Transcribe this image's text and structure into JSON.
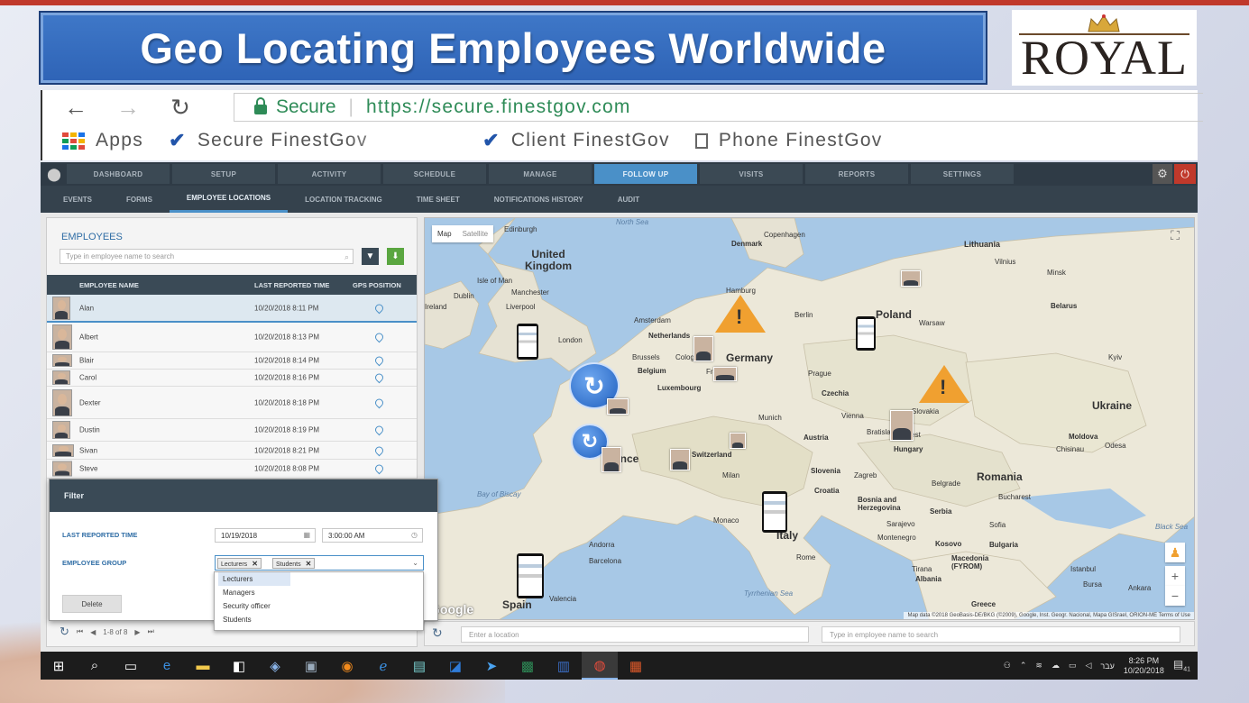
{
  "slide": {
    "title": "Geo Locating Employees Worldwide",
    "logo_text": "ROYAL"
  },
  "browser": {
    "back_icon": "←",
    "forward_icon": "→",
    "reload_icon": "↻",
    "secure_label": "Secure",
    "url": "https://secure.finestgov.com",
    "bookmarks": [
      {
        "label": "Apps"
      },
      {
        "label": "Secure FinestGov"
      },
      {
        "label": "Client FinestGov"
      },
      {
        "label": "Phone FinestGov"
      }
    ]
  },
  "topnav": {
    "tabs": [
      "DASHBOARD",
      "SETUP",
      "ACTIVITY",
      "SCHEDULE",
      "MANAGE",
      "FOLLOW UP",
      "VISITS",
      "REPORTS",
      "SETTINGS"
    ],
    "active": "FOLLOW UP"
  },
  "subnav": {
    "tabs": [
      "EVENTS",
      "FORMS",
      "EMPLOYEE LOCATIONS",
      "LOCATION TRACKING",
      "TIME SHEET",
      "NOTIFICATIONS HISTORY",
      "AUDIT"
    ],
    "active": "EMPLOYEE LOCATIONS"
  },
  "employees": {
    "heading": "EMPLOYEES",
    "search_placeholder": "Type in employee name to search",
    "columns": [
      "EMPLOYEE NAME",
      "LAST REPORTED TIME",
      "GPS POSITION"
    ],
    "rows": [
      {
        "name": "Alan",
        "time": "10/20/2018 8:11 PM"
      },
      {
        "name": "Albert",
        "time": "10/20/2018 8:13 PM"
      },
      {
        "name": "Blair",
        "time": "10/20/2018 8:14 PM"
      },
      {
        "name": "Carol",
        "time": "10/20/2018 8:16 PM"
      },
      {
        "name": "Dexter",
        "time": "10/20/2018 8:18 PM"
      },
      {
        "name": "Dustin",
        "time": "10/20/2018 8:19 PM"
      },
      {
        "name": "Sivan",
        "time": "10/20/2018 8:21 PM"
      },
      {
        "name": "Steve",
        "time": "10/20/2018 8:08 PM"
      }
    ],
    "pager_text": "1-8 of 8"
  },
  "filter": {
    "title": "Filter",
    "last_reported_label": "LAST REPORTED TIME",
    "date_value": "10/19/2018",
    "time_value": "3:00:00 AM",
    "group_label": "EMPLOYEE GROUP",
    "selected_tags": [
      "Lecturers",
      "Students"
    ],
    "delete_label": "Delete",
    "options": [
      "Lecturers",
      "Managers",
      "Security officer",
      "Students"
    ]
  },
  "map": {
    "type_map": "Map",
    "type_satellite": "Satellite",
    "attribution": "Map data ©2018 GeoBasis-DE/BKG (©2009), Google, Inst. Geogr. Nacional, Mapa GISrael, ORION-ME   Terms of Use",
    "google": "Google",
    "labels": [
      {
        "t": "Edinburgh",
        "big": false
      },
      {
        "t": "United Kingdom",
        "big": true
      },
      {
        "t": "Isle of Man",
        "big": false
      },
      {
        "t": "Dublin",
        "big": false
      },
      {
        "t": "Ireland",
        "big": false
      },
      {
        "t": "Manchester",
        "big": false
      },
      {
        "t": "Liverpool",
        "big": false
      },
      {
        "t": "London",
        "big": false
      },
      {
        "t": "Amsterdam",
        "big": false
      },
      {
        "t": "Netherlands",
        "big": false
      },
      {
        "t": "Brussels",
        "big": false
      },
      {
        "t": "Belgium",
        "big": false
      },
      {
        "t": "Luxembourg",
        "big": false
      },
      {
        "t": "Cologne",
        "big": false
      },
      {
        "t": "Frankfurt",
        "big": false
      },
      {
        "t": "Germany",
        "big": true
      },
      {
        "t": "Hamburg",
        "big": false
      },
      {
        "t": "Berlin",
        "big": false
      },
      {
        "t": "Denmark",
        "big": false
      },
      {
        "t": "Copenhagen",
        "big": false
      },
      {
        "t": "Poland",
        "big": true
      },
      {
        "t": "Warsaw",
        "big": false
      },
      {
        "t": "Lithuania",
        "big": false
      },
      {
        "t": "Vilnius",
        "big": false
      },
      {
        "t": "Minsk",
        "big": false
      },
      {
        "t": "Belarus",
        "big": false
      },
      {
        "t": "Prague",
        "big": false
      },
      {
        "t": "Czechia",
        "big": false
      },
      {
        "t": "Munich",
        "big": false
      },
      {
        "t": "Vienna",
        "big": false
      },
      {
        "t": "Austria",
        "big": false
      },
      {
        "t": "Slovakia",
        "big": false
      },
      {
        "t": "Bratislava",
        "big": false
      },
      {
        "t": "Hungary",
        "big": false
      },
      {
        "t": "Budapest",
        "big": false
      },
      {
        "t": "Ukraine",
        "big": true
      },
      {
        "t": "Kyiv",
        "big": false
      },
      {
        "t": "Moldova",
        "big": false
      },
      {
        "t": "Chisinau",
        "big": false
      },
      {
        "t": "Odesa",
        "big": false
      },
      {
        "t": "Romania",
        "big": true
      },
      {
        "t": "Bucharest",
        "big": false
      },
      {
        "t": "Switzerland",
        "big": false
      },
      {
        "t": "Milan",
        "big": false
      },
      {
        "t": "Slovenia",
        "big": false
      },
      {
        "t": "Zagreb",
        "big": false
      },
      {
        "t": "Croatia",
        "big": false
      },
      {
        "t": "Bosnia and Herzegovina",
        "big": false
      },
      {
        "t": "Belgrade",
        "big": false
      },
      {
        "t": "Serbia",
        "big": false
      },
      {
        "t": "Sarajevo",
        "big": false
      },
      {
        "t": "Montenegro",
        "big": false
      },
      {
        "t": "Kosovo",
        "big": false
      },
      {
        "t": "Macedonia (FYROM)",
        "big": false
      },
      {
        "t": "Tirana",
        "big": false
      },
      {
        "t": "Albania",
        "big": false
      },
      {
        "t": "Sofia",
        "big": false
      },
      {
        "t": "Bulgaria",
        "big": false
      },
      {
        "t": "Istanbul",
        "big": false
      },
      {
        "t": "Bursa",
        "big": false
      },
      {
        "t": "Ankara",
        "big": false
      },
      {
        "t": "Greece",
        "big": false
      },
      {
        "t": "Black Sea",
        "big": false
      },
      {
        "t": "Italy",
        "big": true
      },
      {
        "t": "Rome",
        "big": false
      },
      {
        "t": "Monaco",
        "big": false
      },
      {
        "t": "Andorra",
        "big": false
      },
      {
        "t": "Barcelona",
        "big": false
      },
      {
        "t": "Valencia",
        "big": false
      },
      {
        "t": "Spain",
        "big": true
      },
      {
        "t": "France",
        "big": true
      },
      {
        "t": "Bay of Biscay",
        "big": false
      },
      {
        "t": "Tyrrhenian Sea",
        "big": false
      },
      {
        "t": "North Sea",
        "big": false
      }
    ]
  },
  "locbar": {
    "location_placeholder": "Enter a location",
    "employee_placeholder": "Type in employee name to search"
  },
  "taskbar": {
    "lang": "עבר",
    "time": "8:26 PM",
    "date": "10/20/2018",
    "notif": "41"
  }
}
